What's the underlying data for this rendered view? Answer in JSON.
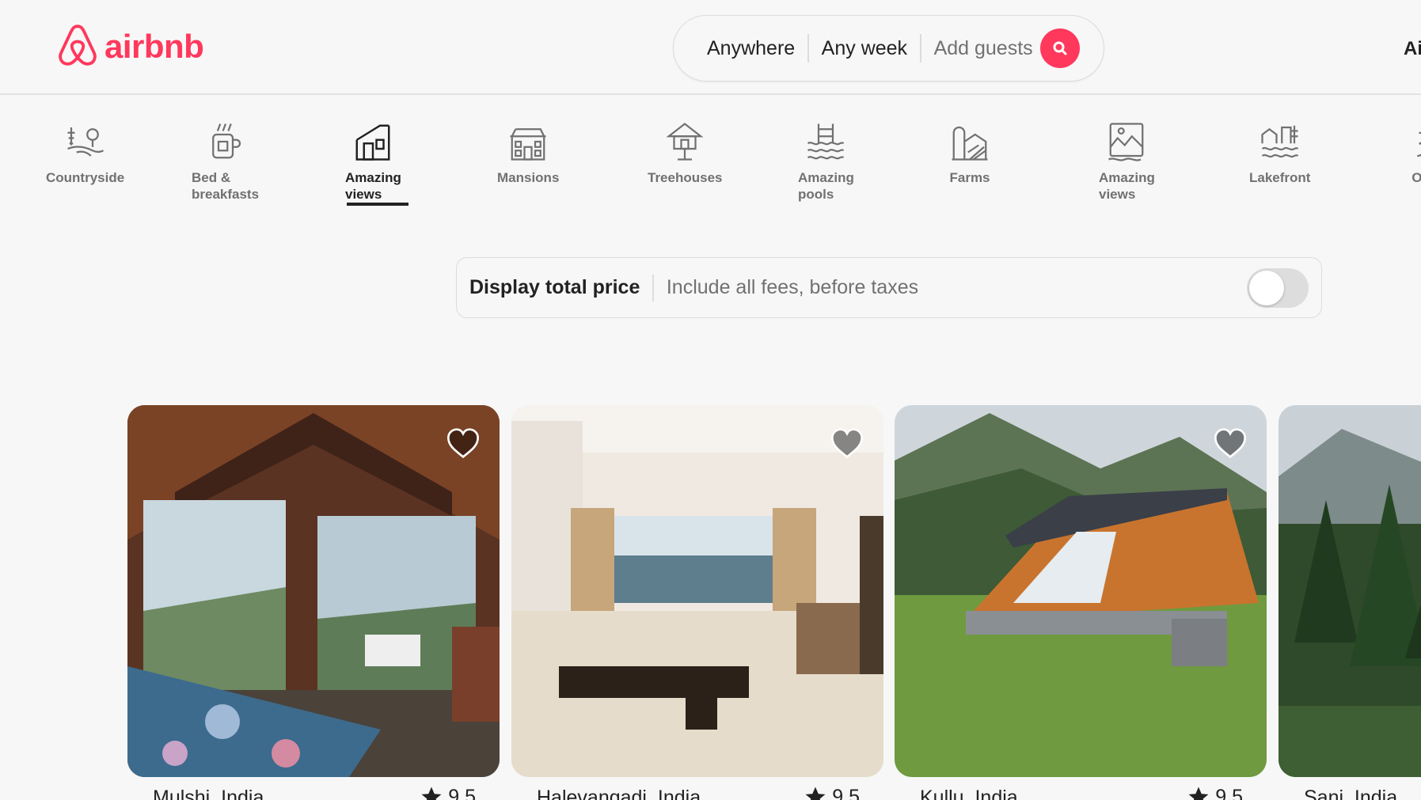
{
  "brand": {
    "name": "airbnb",
    "color": "#ff385c"
  },
  "search": {
    "location": "Anywhere",
    "dates": "Any week",
    "guests_placeholder": "Add guests"
  },
  "header_right": {
    "text": "Ai"
  },
  "categories": [
    {
      "label": "Countryside",
      "icon": "countryside-icon",
      "active": false
    },
    {
      "label": "Bed &\nbreakfasts",
      "icon": "bed-and-breakfast-icon",
      "active": false
    },
    {
      "label": "Amazing\nviews",
      "icon": "amazing-views-icon",
      "active": true
    },
    {
      "label": "Mansions",
      "icon": "mansion-icon",
      "active": false
    },
    {
      "label": "Treehouses",
      "icon": "treehouse-icon",
      "active": false
    },
    {
      "label": "Amazing\npools",
      "icon": "pool-icon",
      "active": false
    },
    {
      "label": "Farms",
      "icon": "farm-icon",
      "active": false
    },
    {
      "label": "Amazing\nviews",
      "icon": "amazing-views-icon",
      "active": false
    },
    {
      "label": "Lakefront",
      "icon": "lakefront-icon",
      "active": false
    },
    {
      "label": "OM",
      "icon": "om-icon",
      "active": false
    }
  ],
  "price_toggle": {
    "title": "Display total price",
    "subtitle": "Include all fees, before taxes",
    "enabled": false
  },
  "listings": [
    {
      "location": "Mulshi, India",
      "rating": "9.5",
      "photo": "wooden-bedroom-with-view"
    },
    {
      "location": "Halevangadi, India",
      "rating": "9.5",
      "photo": "sea-view-living-room"
    },
    {
      "location": "Kullu, India",
      "rating": "9.5",
      "photo": "a-frame-cabin-mountains"
    },
    {
      "location": "Sanj, India",
      "rating": "",
      "photo": "pine-forest-mountains"
    }
  ]
}
